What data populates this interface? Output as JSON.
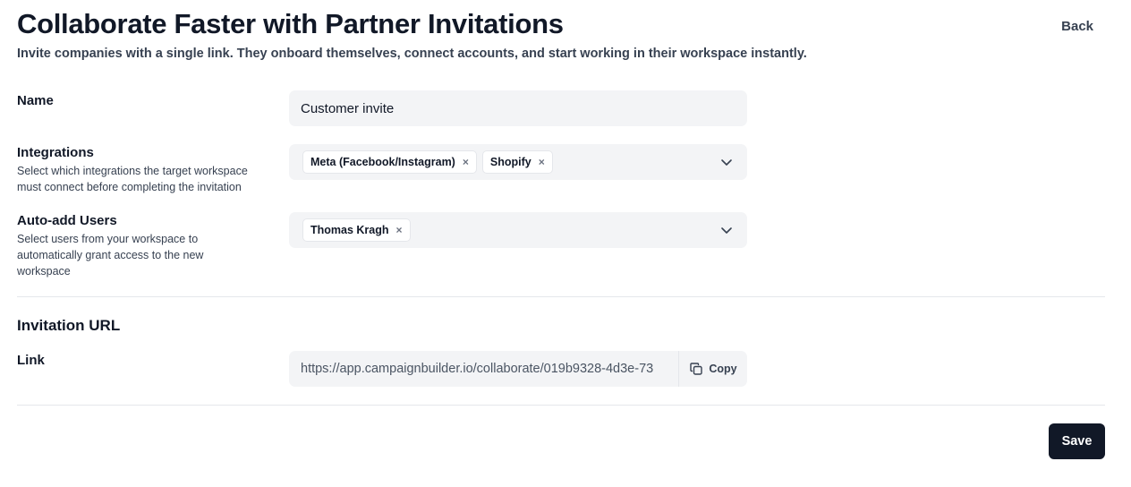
{
  "header": {
    "title": "Collaborate Faster with Partner Invitations",
    "subtitle": "Invite companies with a single link. They onboard themselves, connect accounts, and start working in their workspace instantly.",
    "back_label": "Back"
  },
  "form": {
    "name": {
      "label": "Name",
      "value": "Customer invite"
    },
    "integrations": {
      "label": "Integrations",
      "help": "Select which integrations the target workspace must connect before completing the invitation",
      "selected": [
        "Meta (Facebook/Instagram)",
        "Shopify"
      ],
      "icon": "chevron-down-icon"
    },
    "auto_add_users": {
      "label": "Auto-add Users",
      "help": "Select users from your workspace to automatically grant access to the new workspace",
      "selected": [
        "Thomas Kragh"
      ],
      "icon": "chevron-down-icon"
    }
  },
  "invitation": {
    "section_title": "Invitation URL",
    "link_label": "Link",
    "url": "https://app.campaignbuilder.io/collaborate/019b9328-4d3e-73",
    "copy_label": "Copy",
    "copy_icon": "copy-icon"
  },
  "footer": {
    "save_label": "Save"
  },
  "chip_remove_glyph": "×"
}
